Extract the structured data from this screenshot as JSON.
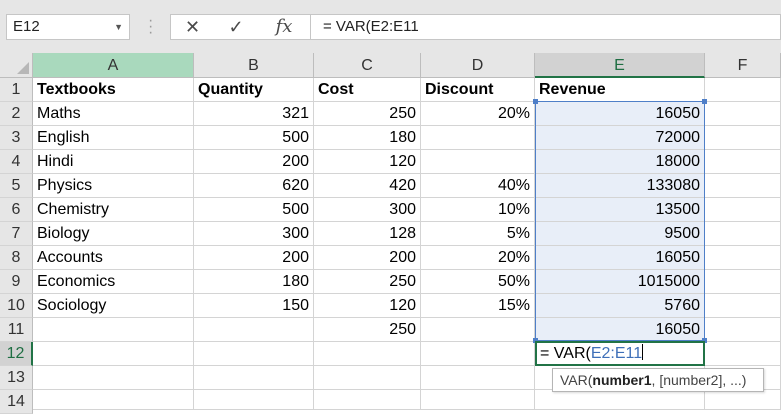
{
  "name_box": {
    "value": "E12"
  },
  "formula_bar": {
    "cancel_symbol": "✕",
    "enter_symbol": "✓",
    "fx_label": "fx",
    "value": "= VAR(E2:E11"
  },
  "columns": [
    "A",
    "B",
    "C",
    "D",
    "E",
    "F"
  ],
  "rows": [
    "1",
    "2",
    "3",
    "4",
    "5",
    "6",
    "7",
    "8",
    "9",
    "10",
    "11",
    "12",
    "13",
    "14"
  ],
  "headers": {
    "A": "Textbooks",
    "B": "Quantity",
    "C": "Cost",
    "D": "Discount",
    "E": "Revenue"
  },
  "data": [
    {
      "A": "Maths",
      "B": "321",
      "C": "250",
      "D": "20%",
      "E": "16050"
    },
    {
      "A": "English",
      "B": "500",
      "C": "180",
      "D": "",
      "E": "72000"
    },
    {
      "A": "Hindi",
      "B": "200",
      "C": "120",
      "D": "",
      "E": "18000"
    },
    {
      "A": "Physics",
      "B": "620",
      "C": "420",
      "D": "40%",
      "E": "133080"
    },
    {
      "A": "Chemistry",
      "B": "500",
      "C": "300",
      "D": "10%",
      "E": "13500"
    },
    {
      "A": "Biology",
      "B": "300",
      "C": "128",
      "D": "5%",
      "E": "9500"
    },
    {
      "A": "Accounts",
      "B": "200",
      "C": "200",
      "D": "20%",
      "E": "16050"
    },
    {
      "A": "Economics",
      "B": "180",
      "C": "250",
      "D": "50%",
      "E": "1015000"
    },
    {
      "A": "Sociology",
      "B": "150",
      "C": "120",
      "D": "15%",
      "E": "5760"
    },
    {
      "A": "",
      "B": "",
      "C": "250",
      "D": "",
      "E": "16050"
    }
  ],
  "active_cell": {
    "prefix": "= VAR(",
    "reference": "E2:E11"
  },
  "tooltip": {
    "func": "VAR(",
    "arg1": "number1",
    "rest": ", [number2], ...)"
  },
  "colors": {
    "accent_green": "#217346",
    "range_blue": "#4f7fc8",
    "range_fill": "#e8eef8"
  }
}
